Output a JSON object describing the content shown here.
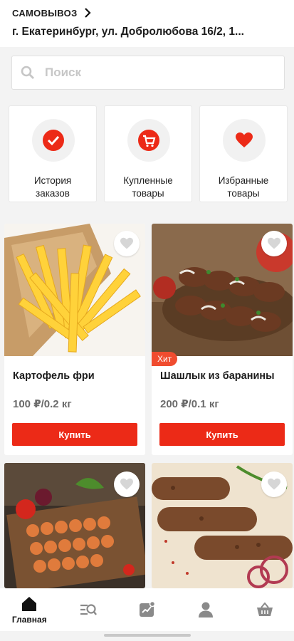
{
  "header": {
    "pickup_label": "САМОВЫВОЗ",
    "address": "г. Екатеринбург, ул. Добролюбова 16/2, 1..."
  },
  "search": {
    "placeholder": "Поиск"
  },
  "quick_actions": [
    {
      "label": "История\nзаказов",
      "icon": "check-circle-icon"
    },
    {
      "label": "Купленные\nтовары",
      "icon": "cart-check-icon"
    },
    {
      "label": "Избранные\nтовары",
      "icon": "heart-icon"
    }
  ],
  "products": [
    {
      "title": "Картофель фри",
      "price": "100 ₽/0.2 кг",
      "button": "Купить",
      "badge": ""
    },
    {
      "title": "Шашлык из баранины",
      "price": "200 ₽/0.1 кг",
      "button": "Купить",
      "badge": "Хит"
    },
    {
      "title": "",
      "price": "",
      "button": "",
      "badge": ""
    },
    {
      "title": "",
      "price": "",
      "button": "",
      "badge": ""
    }
  ],
  "tabbar": [
    {
      "label": "Главная",
      "icon": "home-icon",
      "active": true
    },
    {
      "label": "",
      "icon": "catalog-search-icon"
    },
    {
      "label": "",
      "icon": "promo-chart-icon"
    },
    {
      "label": "",
      "icon": "profile-icon"
    },
    {
      "label": "",
      "icon": "basket-icon"
    }
  ],
  "colors": {
    "accent": "#ec2a17",
    "badge": "#f04c2f",
    "background": "#f3f3f3"
  }
}
